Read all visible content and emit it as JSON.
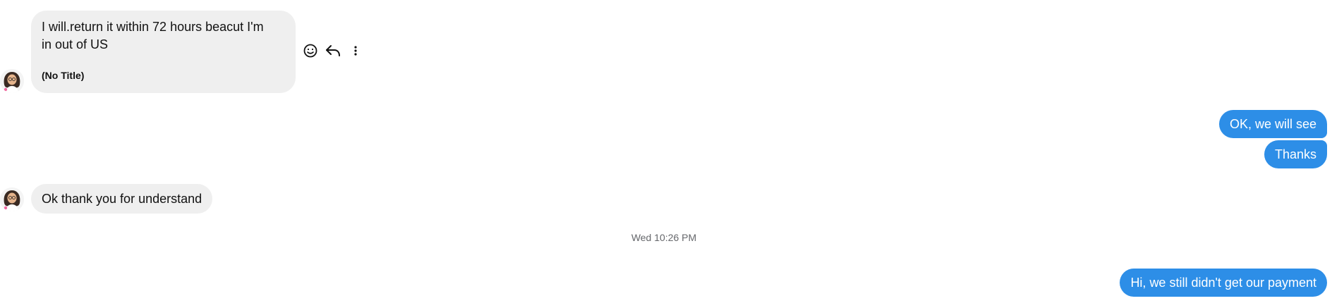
{
  "messages": {
    "incoming_1": {
      "line1": "I will.return it within 72 hours beacut I'm",
      "line2": "in out of US",
      "subtitle": "(No Title)"
    },
    "outgoing_1": "OK, we will see",
    "outgoing_2": "Thanks",
    "incoming_2": "Ok thank you for understand",
    "timestamp": "Wed 10:26 PM",
    "outgoing_3": "Hi, we still didn't get our payment"
  },
  "actions": {
    "icons": [
      "smiley-icon",
      "reply-icon",
      "more-vertical-icon"
    ]
  },
  "colors": {
    "incoming_bubble": "#efefef",
    "outgoing_bubble": "#2d8ee7",
    "timestamp_text": "#65676b"
  }
}
